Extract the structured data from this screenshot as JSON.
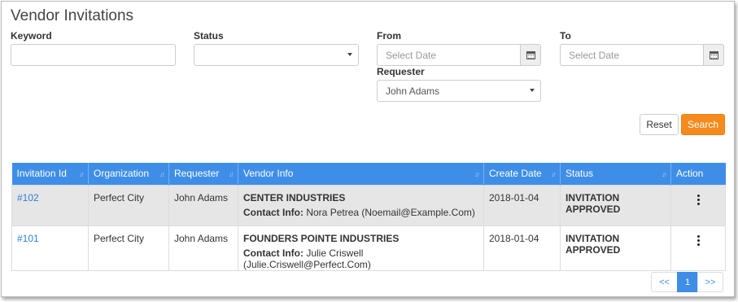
{
  "page": {
    "title": "Vendor Invitations"
  },
  "filters": {
    "keyword": {
      "label": "Keyword",
      "value": "",
      "placeholder": ""
    },
    "status": {
      "label": "Status",
      "value": ""
    },
    "from": {
      "label": "From",
      "placeholder": "Select Date"
    },
    "to": {
      "label": "To",
      "placeholder": "Select Date"
    },
    "requester": {
      "label": "Requester",
      "value": "John Adams"
    }
  },
  "buttons": {
    "reset": "Reset",
    "search": "Search"
  },
  "colors": {
    "accent": "#3e8ee8",
    "search_button": "#f58b1e",
    "link": "#2f7ed8"
  },
  "table": {
    "headers": [
      "Invitation Id",
      "Organization",
      "Requester",
      "Vendor Info",
      "Create Date",
      "Status",
      "Action"
    ],
    "sort_icon": "↓↑",
    "contact_label": "Contact Info:",
    "rows": [
      {
        "id": "#102",
        "organization": "Perfect City",
        "requester": "John Adams",
        "vendor_name": "CENTER INDUSTRIES",
        "contact": "Nora Petrea (Noemail@Example.Com)",
        "create_date": "2018-01-04",
        "status": "INVITATION APPROVED"
      },
      {
        "id": "#101",
        "organization": "Perfect City",
        "requester": "John Adams",
        "vendor_name": "FOUNDERS POINTE INDUSTRIES",
        "contact": "Julie Criswell (Julie.Criswell@Perfect.Com)",
        "create_date": "2018-01-04",
        "status": "INVITATION APPROVED"
      }
    ]
  },
  "pagination": {
    "prev": "<<",
    "current": "1",
    "next": ">>"
  }
}
